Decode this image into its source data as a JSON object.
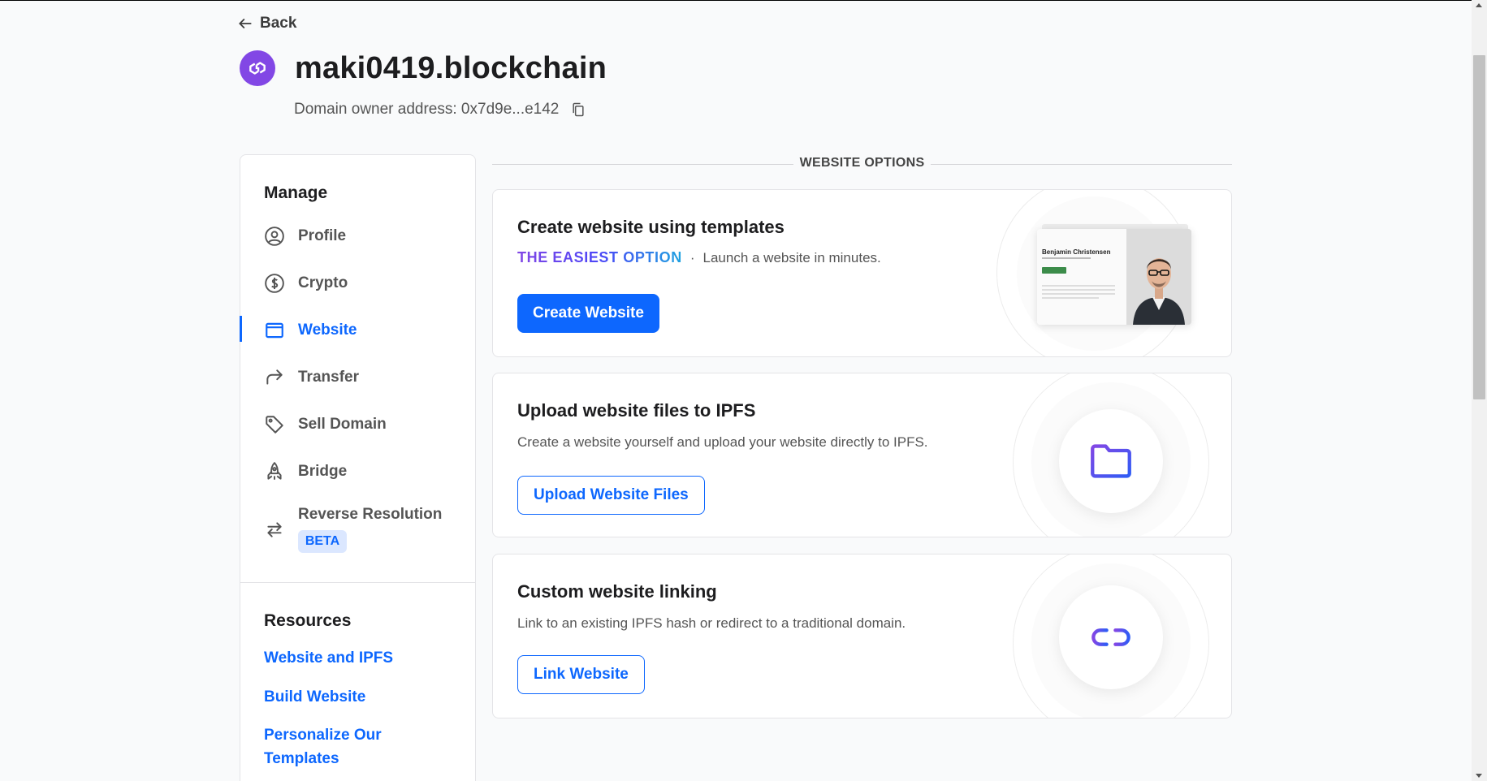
{
  "header": {
    "back_label": "Back",
    "domain_name": "maki0419.blockchain",
    "owner_label": "Domain owner address: 0x7d9e...e142"
  },
  "sidebar": {
    "manage_heading": "Manage",
    "items": [
      {
        "label": "Profile",
        "icon": "user-circle-icon"
      },
      {
        "label": "Crypto",
        "icon": "dollar-circle-icon"
      },
      {
        "label": "Website",
        "icon": "browser-window-icon",
        "active": true
      },
      {
        "label": "Transfer",
        "icon": "arrow-forward-icon"
      },
      {
        "label": "Sell Domain",
        "icon": "tag-icon"
      },
      {
        "label": "Bridge",
        "icon": "rocket-icon"
      },
      {
        "label": "Reverse Resolution",
        "icon": "swap-arrows-icon",
        "badge": "BETA"
      }
    ],
    "resources_heading": "Resources",
    "resources": [
      "Website and IPFS",
      "Build Website",
      "Personalize Our Templates"
    ]
  },
  "main": {
    "section_label": "WEBSITE OPTIONS",
    "cards": [
      {
        "title": "Create website using templates",
        "tagline": "THE EASIEST OPTION",
        "separator": "·",
        "description": "Launch a website in minutes.",
        "button": "Create Website",
        "preview_name": "Benjamin Christensen"
      },
      {
        "title": "Upload website files to IPFS",
        "description": "Create a website yourself and upload your website directly to IPFS.",
        "button": "Upload Website Files",
        "icon": "folder-icon"
      },
      {
        "title": "Custom website linking",
        "description": "Link to an existing IPFS hash or redirect to a traditional domain.",
        "button": "Link Website",
        "icon": "link-icon"
      }
    ]
  },
  "colors": {
    "accent": "#0d67fe",
    "polygon_purple": "#8247e5",
    "background": "#f9fafb"
  }
}
